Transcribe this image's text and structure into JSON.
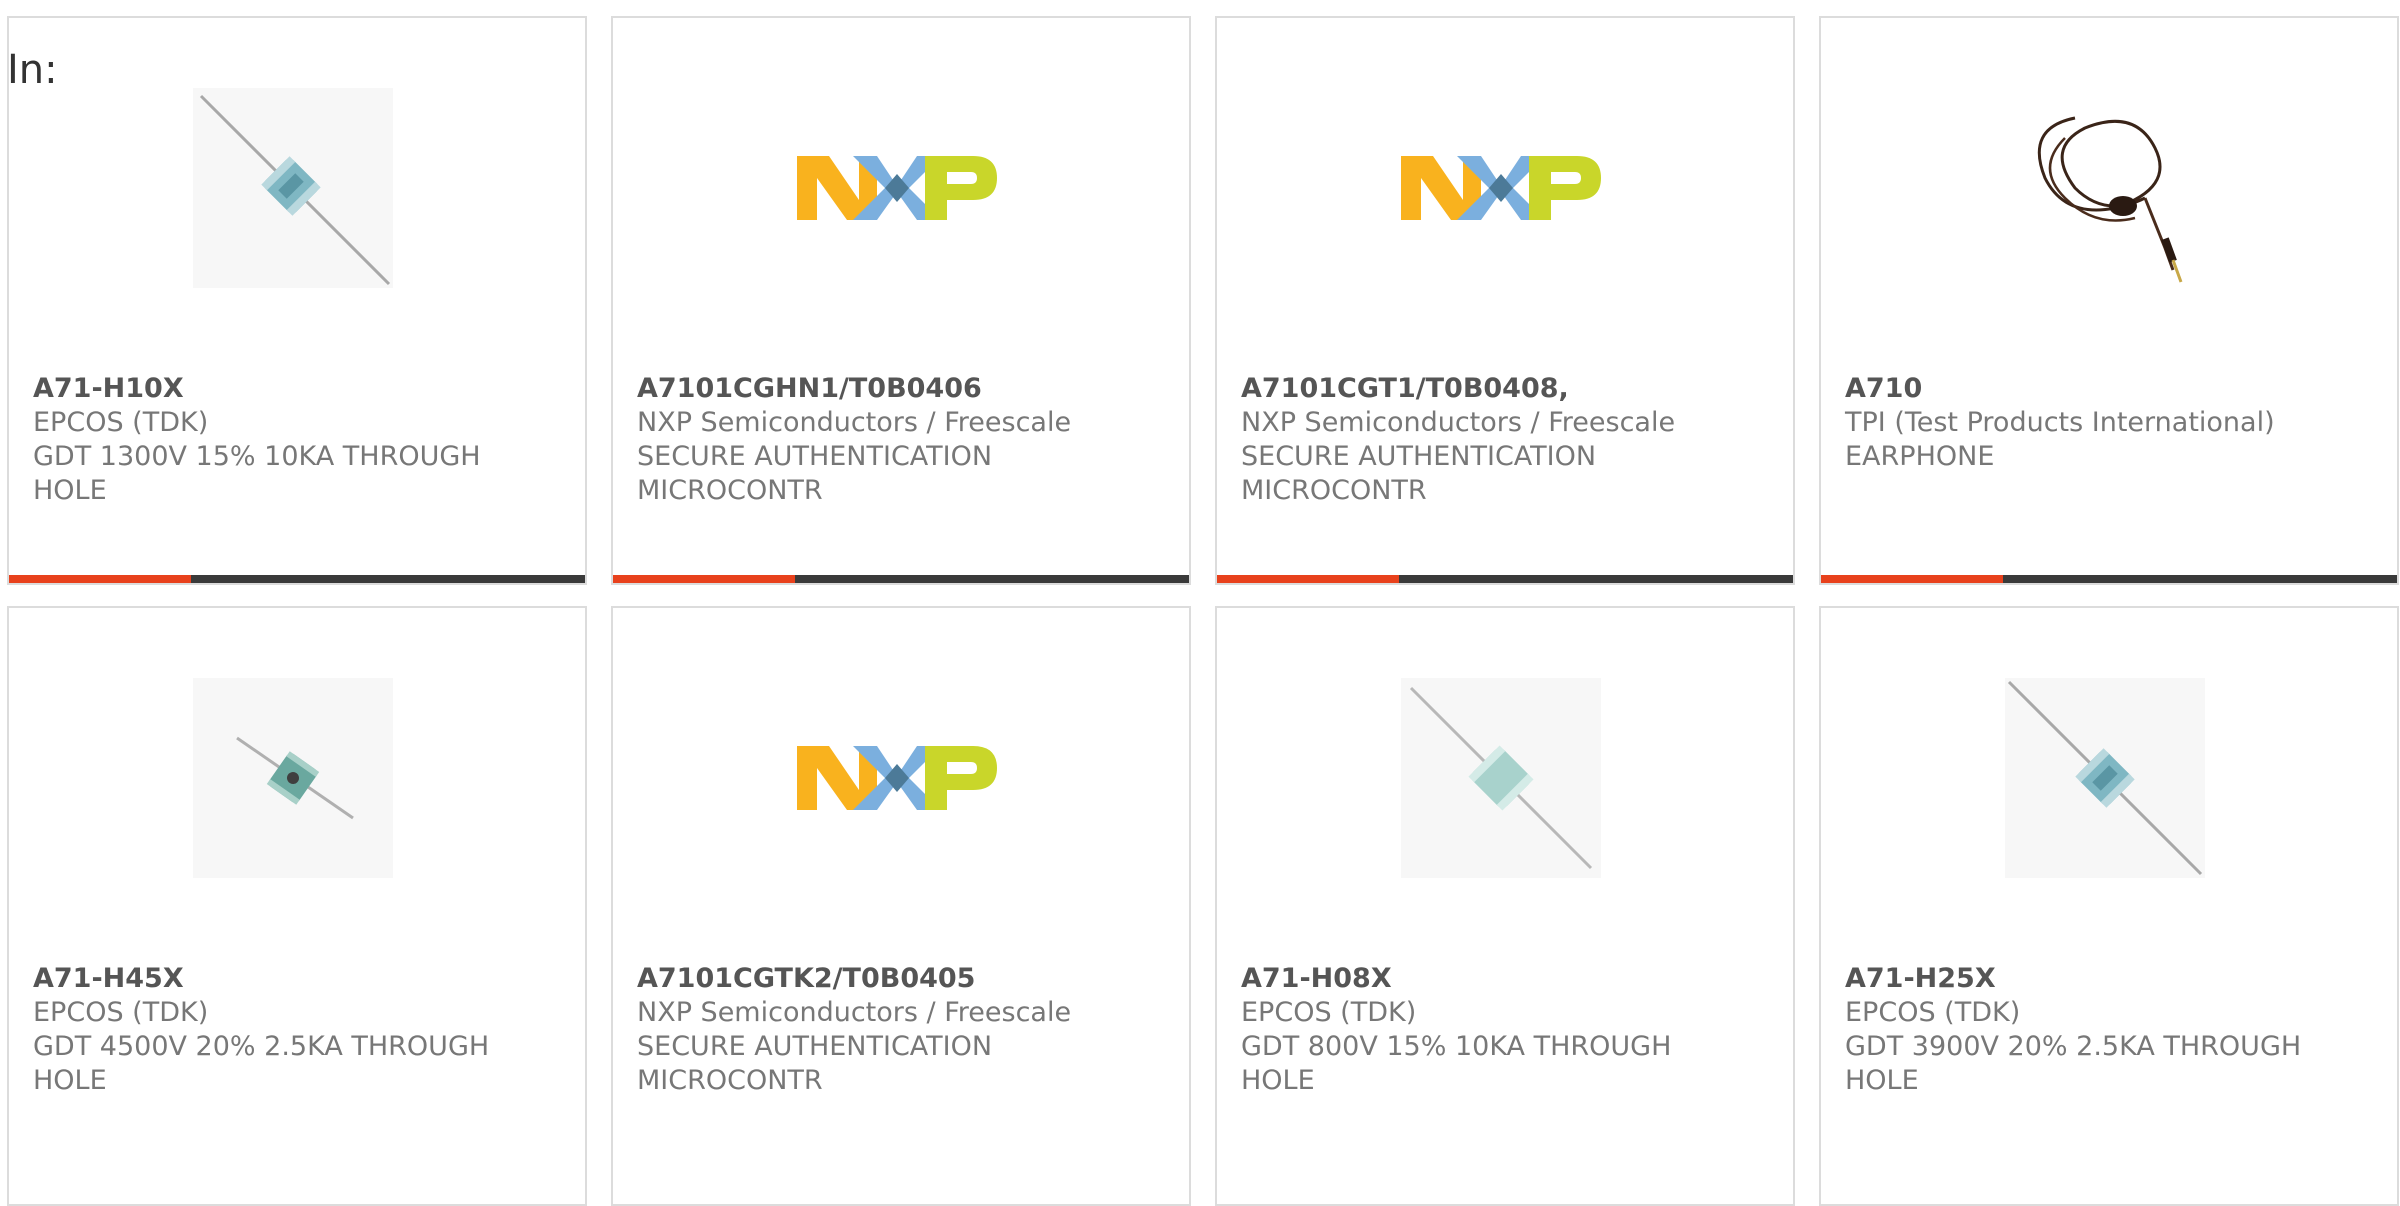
{
  "filter": {
    "label": "In:"
  },
  "products": [
    {
      "part_number": "A71-H10X",
      "manufacturer": "EPCOS (TDK)",
      "description": "GDT 1300V 15% 10KA THROUGH HOLE",
      "image": "gas-discharge-tube-long-leads"
    },
    {
      "part_number": "A7101CGHN1/T0B0406",
      "manufacturer": "NXP Semiconductors / Freescale",
      "description": "SECURE AUTHENTICATION MICROCONTR",
      "image": "nxp-logo"
    },
    {
      "part_number": "A7101CGT1/T0B0408,",
      "manufacturer": "NXP Semiconductors / Freescale",
      "description": "SECURE AUTHENTICATION MICROCONTR",
      "image": "nxp-logo"
    },
    {
      "part_number": "A710",
      "manufacturer": "TPI (Test Products International)",
      "description": "EARPHONE",
      "image": "earphone"
    },
    {
      "part_number": "A71-H45X",
      "manufacturer": "EPCOS (TDK)",
      "description": "GDT 4500V 20% 2.5KA THROUGH HOLE",
      "image": "gas-discharge-tube-short"
    },
    {
      "part_number": "A7101CGTK2/T0B0405",
      "manufacturer": "NXP Semiconductors / Freescale",
      "description": "SECURE AUTHENTICATION MICROCONTR",
      "image": "nxp-logo"
    },
    {
      "part_number": "A71-H08X",
      "manufacturer": "EPCOS (TDK)",
      "description": "GDT 800V 15% 10KA THROUGH HOLE",
      "image": "gas-discharge-tube-light"
    },
    {
      "part_number": "A71-H25X",
      "manufacturer": "EPCOS (TDK)",
      "description": "GDT 3900V 20% 2.5KA THROUGH HOLE",
      "image": "gas-discharge-tube-long-leads"
    }
  ],
  "colors": {
    "accent": "#e8411c",
    "bar": "#3a3a3a",
    "border": "#dcdcdc",
    "nxp_orange": "#f9b21e",
    "nxp_blue": "#7bafde",
    "nxp_green": "#c9d62a"
  }
}
